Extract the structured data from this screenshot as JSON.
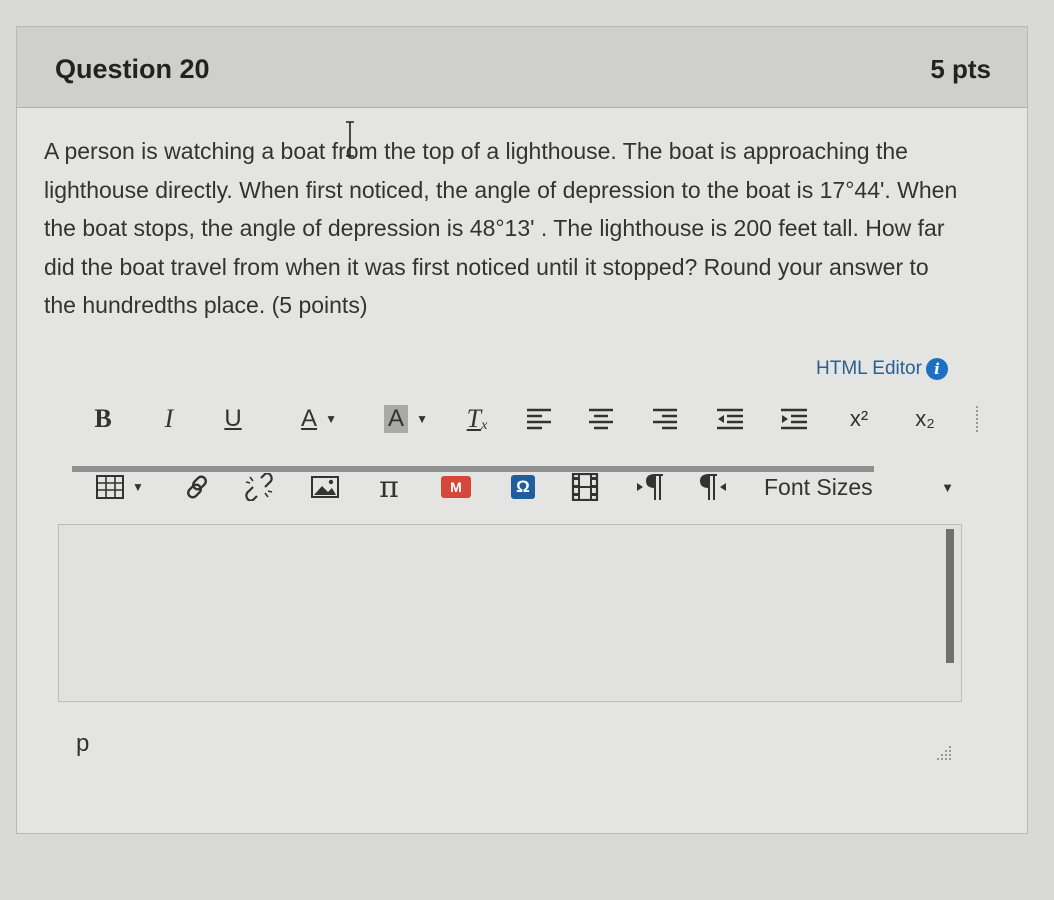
{
  "question": {
    "title": "Question 20",
    "points": "5 pts",
    "text": "A person is watching a boat from the top of a lighthouse. The boat is approaching the lighthouse directly. When first noticed, the angle of depression to the boat is 17°44'. When the boat stops, the angle of depression is 48°13' . The lighthouse is 200 feet tall. How far did the boat travel from when it was first noticed until it stopped? Round your answer to the hundredths place. (5 points)"
  },
  "editor": {
    "html_editor_label": "HTML Editor",
    "font_sizes_label": "Font Sizes",
    "value": "",
    "path": "p",
    "toolbar_row1": [
      "bold-button",
      "italic-button",
      "underline-button",
      "text-color-button",
      "background-color-button",
      "clear-formatting-button",
      "align-left-button",
      "align-center-button",
      "align-right-button",
      "outdent-button",
      "indent-button",
      "superscript-button",
      "subscript-button"
    ],
    "toolbar_row2": [
      "table-button",
      "link-button",
      "unlink-button",
      "image-button",
      "equation-button",
      "media-button",
      "record-button",
      "embed-button",
      "ltr-button",
      "rtl-button",
      "font-sizes-select"
    ]
  },
  "glyphs": {
    "bold": "B",
    "italic": "I",
    "underline": "U",
    "text_color": "A",
    "bg_color": "A",
    "clear_fmt": "T",
    "clear_fmt_sub": "x",
    "superscript": "x²",
    "subscript": "x₂",
    "pi": "π",
    "info": "i",
    "media_letter": "M",
    "embed_letter": "Ω",
    "rtl": "¶"
  },
  "colors": {
    "link": "#2a5f92",
    "info_icon": "#1d6fc2",
    "media_icon": "#d4473a",
    "embed_icon": "#1f5d9c"
  }
}
